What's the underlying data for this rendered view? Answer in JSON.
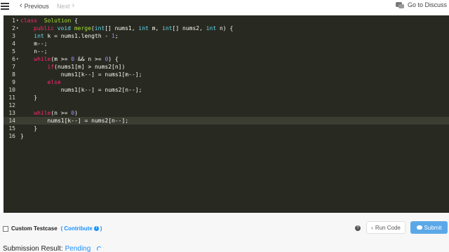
{
  "topbar": {
    "menu_icon": "hamburger-icon",
    "previous_label": "Previous",
    "next_label": "Next",
    "discuss_label": "Go to Discuss"
  },
  "editor": {
    "lines": [
      {
        "n": "1",
        "fold": true
      },
      {
        "n": "2",
        "fold": true
      },
      {
        "n": "3",
        "fold": false
      },
      {
        "n": "4",
        "fold": false
      },
      {
        "n": "5",
        "fold": false
      },
      {
        "n": "6",
        "fold": true
      },
      {
        "n": "7",
        "fold": false
      },
      {
        "n": "8",
        "fold": false
      },
      {
        "n": "9",
        "fold": false
      },
      {
        "n": "10",
        "fold": false
      },
      {
        "n": "11",
        "fold": false
      },
      {
        "n": "12",
        "fold": false
      },
      {
        "n": "13",
        "fold": false
      },
      {
        "n": "14",
        "fold": false
      },
      {
        "n": "15",
        "fold": false
      },
      {
        "n": "16",
        "fold": false
      }
    ],
    "code": [
      [
        [
          "kw",
          "class"
        ],
        [
          "",
          "  "
        ],
        [
          "cls",
          "Solution"
        ],
        [
          "",
          " {"
        ]
      ],
      [
        [
          "",
          ""
        ],
        [
          "kw",
          "public"
        ],
        [
          "",
          " "
        ],
        [
          "ty",
          "void"
        ],
        [
          "",
          " "
        ],
        [
          "cls",
          "merge"
        ],
        [
          "",
          "("
        ],
        [
          "ty",
          "int"
        ],
        [
          "",
          "[] nums1, "
        ],
        [
          "ty",
          "int"
        ],
        [
          "",
          " m, "
        ],
        [
          "ty",
          "int"
        ],
        [
          "",
          "[] nums2, "
        ],
        [
          "ty",
          "int"
        ],
        [
          "",
          " n) {"
        ]
      ],
      [
        [
          "",
          "    "
        ],
        [
          "ty",
          "int"
        ],
        [
          "",
          " k = nums1.length - "
        ],
        [
          "num",
          "1"
        ],
        [
          "",
          ";"
        ]
      ],
      [
        [
          "",
          "    m--;"
        ]
      ],
      [
        [
          "",
          "    n--;"
        ]
      ],
      [
        [
          "",
          "    "
        ],
        [
          "kw",
          "while"
        ],
        [
          "",
          "(m >= "
        ],
        [
          "num",
          "0"
        ],
        [
          "",
          " && n >= "
        ],
        [
          "num",
          "0"
        ],
        [
          "",
          ") {"
        ]
      ],
      [
        [
          "",
          "        "
        ],
        [
          "kw",
          "if"
        ],
        [
          "",
          "(nums1[m] > nums2[n])"
        ]
      ],
      [
        [
          "",
          "            nums1[k--] = nums1[m--];"
        ]
      ],
      [
        [
          "",
          "        "
        ],
        [
          "kw",
          "else"
        ]
      ],
      [
        [
          "",
          "            nums1[k--] = nums2[n--];"
        ]
      ],
      [
        [
          "",
          "    }"
        ]
      ],
      [
        [
          "",
          ""
        ]
      ],
      [
        [
          "",
          "    "
        ],
        [
          "kw",
          "while"
        ],
        [
          "",
          "(n >= "
        ],
        [
          "num",
          "0"
        ],
        [
          "",
          ")"
        ]
      ],
      [
        [
          "",
          "        nums1[k--] = nums2[n--];"
        ]
      ],
      [
        [
          "",
          "    }"
        ]
      ],
      [
        [
          "",
          "}"
        ]
      ]
    ],
    "active_line": 14
  },
  "bottom": {
    "custom_testcase_label": "Custom Testcase",
    "contribute_label": "Contribute",
    "paren_open": "(",
    "paren_close": ")",
    "run_code_label": "Run Code",
    "submit_label": "Submit",
    "result_label": "Submission Result:",
    "result_status": "Pending"
  },
  "colors": {
    "editor_bg": "#282a21",
    "keyword": "#f92672",
    "type": "#66d9ef",
    "class_name": "#a6e22e",
    "number": "#ae81ff",
    "link_blue": "#1a90ff",
    "submit_bg": "#5ba8e8"
  }
}
